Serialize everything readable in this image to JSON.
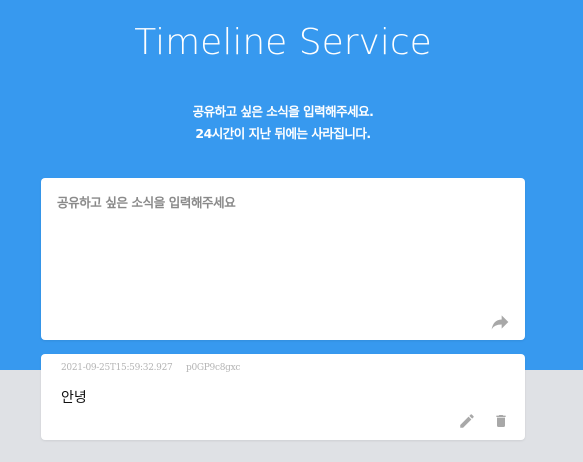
{
  "header": {
    "title": "Timeline Service",
    "subtitle_line1": "공유하고 싶은 소식을 입력해주세요.",
    "subtitle_line2": "24시간이 지난 뒤에는 사라집니다."
  },
  "composer": {
    "placeholder": "공유하고 싶은 소식을 입력해주세요",
    "value": "",
    "submit_icon": "share-icon"
  },
  "posts": [
    {
      "timestamp": "2021-09-25T15:59:32.927",
      "author_id": "p0GP9c8gxc",
      "content": "안녕",
      "edit_icon": "pencil-icon",
      "delete_icon": "trash-icon"
    }
  ],
  "colors": {
    "hero_bg": "#3799ef",
    "page_bg": "#dfe1e5",
    "icon_gray": "#a8a8a8"
  }
}
